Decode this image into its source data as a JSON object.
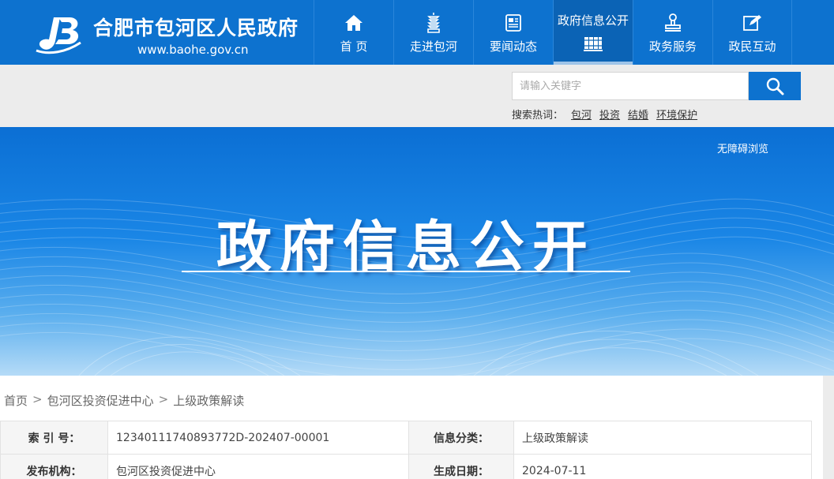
{
  "header": {
    "site_name": "合肥市包河区人民政府",
    "site_url": "www.baohe.gov.cn",
    "brand_color": "#0d72cf",
    "nav": [
      {
        "label": "首 页",
        "icon": "home-icon",
        "active": false
      },
      {
        "label": "走进包河",
        "icon": "pagoda-icon",
        "active": false
      },
      {
        "label": "要闻动态",
        "icon": "newspaper-icon",
        "active": false
      },
      {
        "label": "政府信息公开",
        "icon": "books-icon",
        "active": true
      },
      {
        "label": "政务服务",
        "icon": "stamp-icon",
        "active": false
      },
      {
        "label": "政民互动",
        "icon": "edit-icon",
        "active": false
      }
    ]
  },
  "search": {
    "placeholder": "请输入关键字",
    "hot_label": "搜索热词：",
    "hot_words": [
      "包河",
      "投资",
      "结婚",
      "环境保护"
    ]
  },
  "banner": {
    "accessibility": "无障碍浏览",
    "title": "政府信息公开"
  },
  "breadcrumb": {
    "items": [
      "首页",
      "包河区投资促进中心",
      "上级政策解读"
    ],
    "separator": ">"
  },
  "info": {
    "index_label": "索 引 号：",
    "index_value": "12340111740893772D-202407-00001",
    "category_label": "信息分类：",
    "category_value": "上级政策解读",
    "publisher_label": "发布机构：",
    "publisher_value": "包河区投资促进中心",
    "date_label": "生成日期：",
    "date_value": "2024-07-11"
  }
}
